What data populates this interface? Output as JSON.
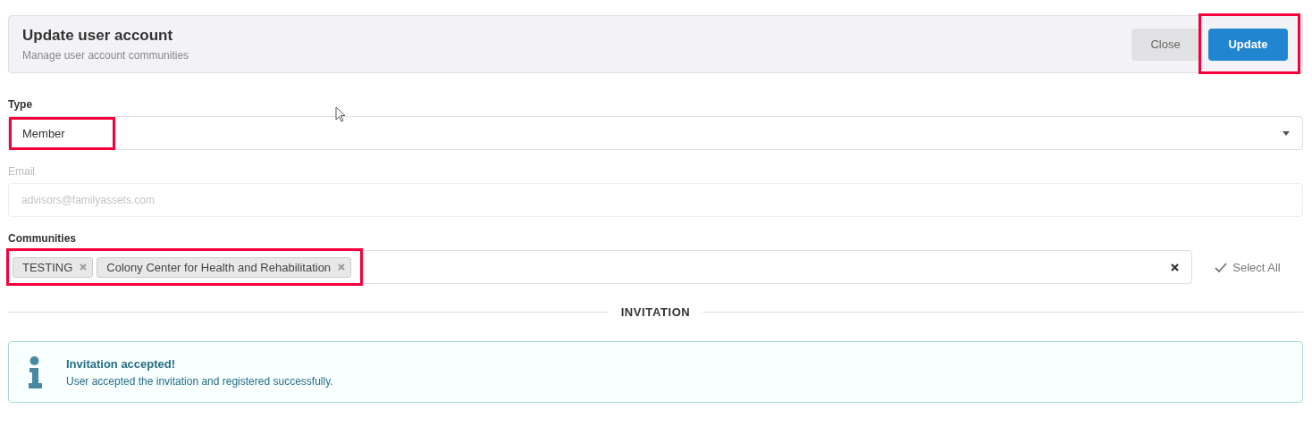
{
  "header": {
    "title": "Update user account",
    "subtitle": "Manage user account communities",
    "buttons": [
      {
        "label": "Close",
        "kind": "secondary",
        "highlighted": false
      },
      {
        "label": "Update",
        "kind": "primary",
        "highlighted": true
      }
    ]
  },
  "fields": [
    {
      "kind": "select",
      "label": "Type",
      "value": "Member",
      "disabled": false,
      "highlighted": true
    },
    {
      "kind": "text",
      "label": "Email",
      "value": "advisors@familyassets.com",
      "disabled": true,
      "highlighted": false
    },
    {
      "kind": "tags",
      "label": "Communities",
      "tags": [
        "TESTING",
        "Colony Center for Health and Rehabilitation"
      ],
      "action": "Select All",
      "disabled": false,
      "highlighted": true
    }
  ],
  "divider": {
    "label": "INVITATION"
  },
  "alert": {
    "title": "Invitation accepted!",
    "message": "User accepted the invitation and registered successfully."
  }
}
